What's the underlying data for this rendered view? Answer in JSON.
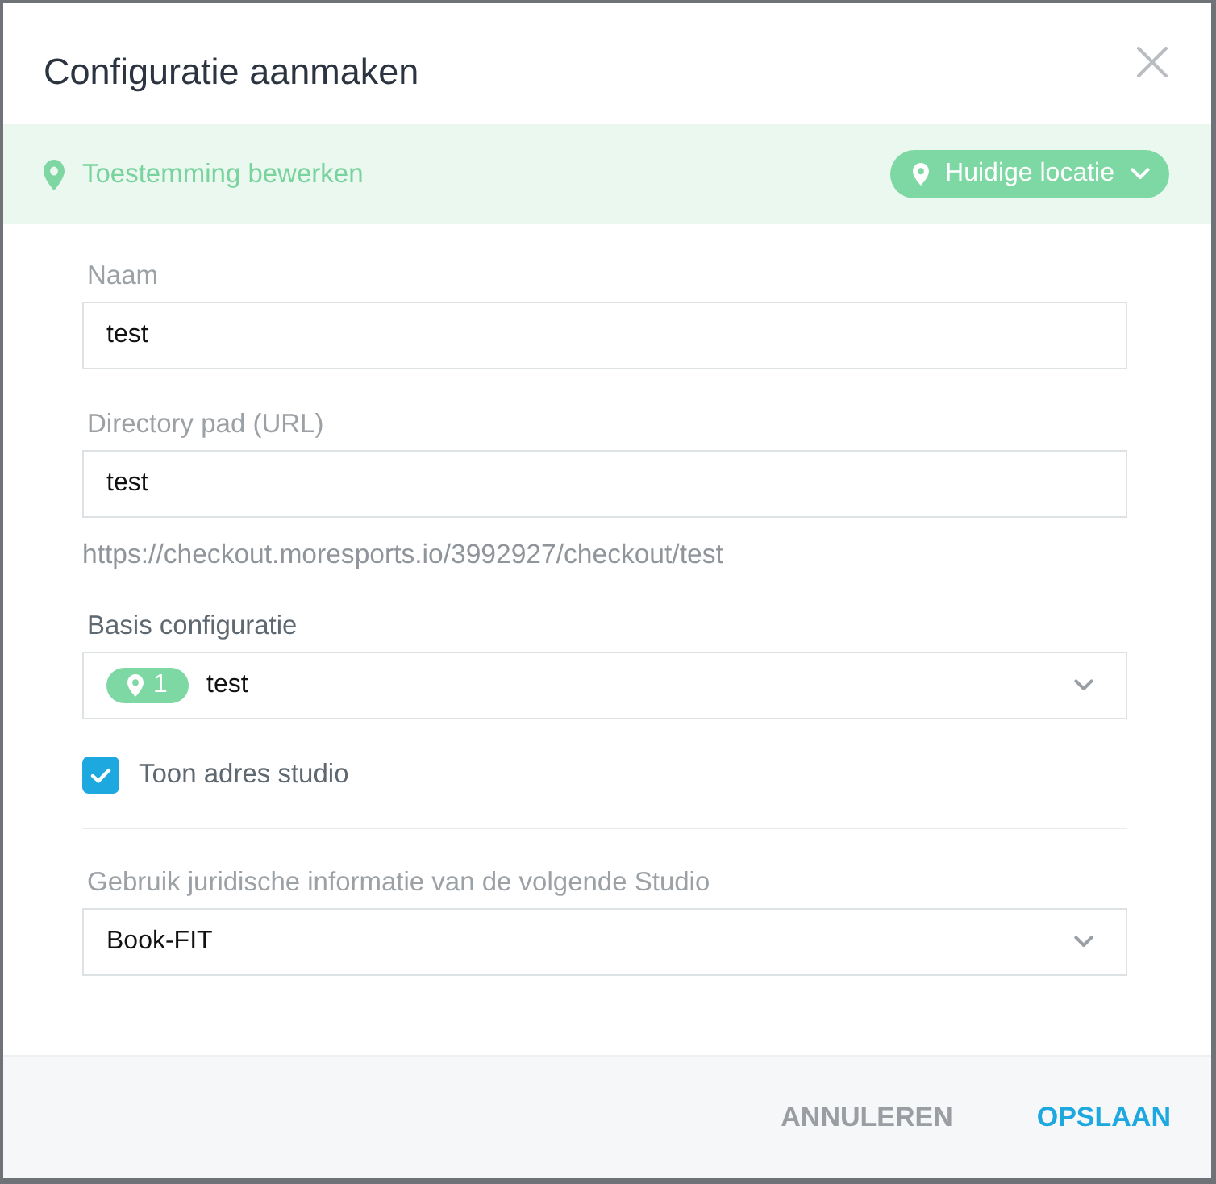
{
  "dialog": {
    "title": "Configuratie aanmaken"
  },
  "permission_bar": {
    "label": "Toestemming bewerken",
    "location_button": {
      "label": "Huidige locatie"
    }
  },
  "sections": [
    {
      "fields": [
        {
          "kind": "text",
          "label": "Naam",
          "value": "test"
        },
        {
          "kind": "text",
          "label": "Directory pad (URL)",
          "value": "test",
          "hint": "https://checkout.moresports.io/3992927/checkout/test"
        },
        {
          "kind": "badge-select",
          "label": "Basis configuratie",
          "badge": "1",
          "value": "test"
        },
        {
          "kind": "checkbox",
          "label": "Toon adres studio",
          "checked": true
        }
      ]
    },
    {
      "fields": [
        {
          "kind": "select",
          "label": "Gebruik juridische informatie van de volgende Studio",
          "value": "Book-FIT"
        }
      ]
    }
  ],
  "buttons": [
    {
      "kind": "secondary",
      "label": "ANNULEREN"
    },
    {
      "kind": "primary",
      "label": "OPSLAAN"
    }
  ]
}
